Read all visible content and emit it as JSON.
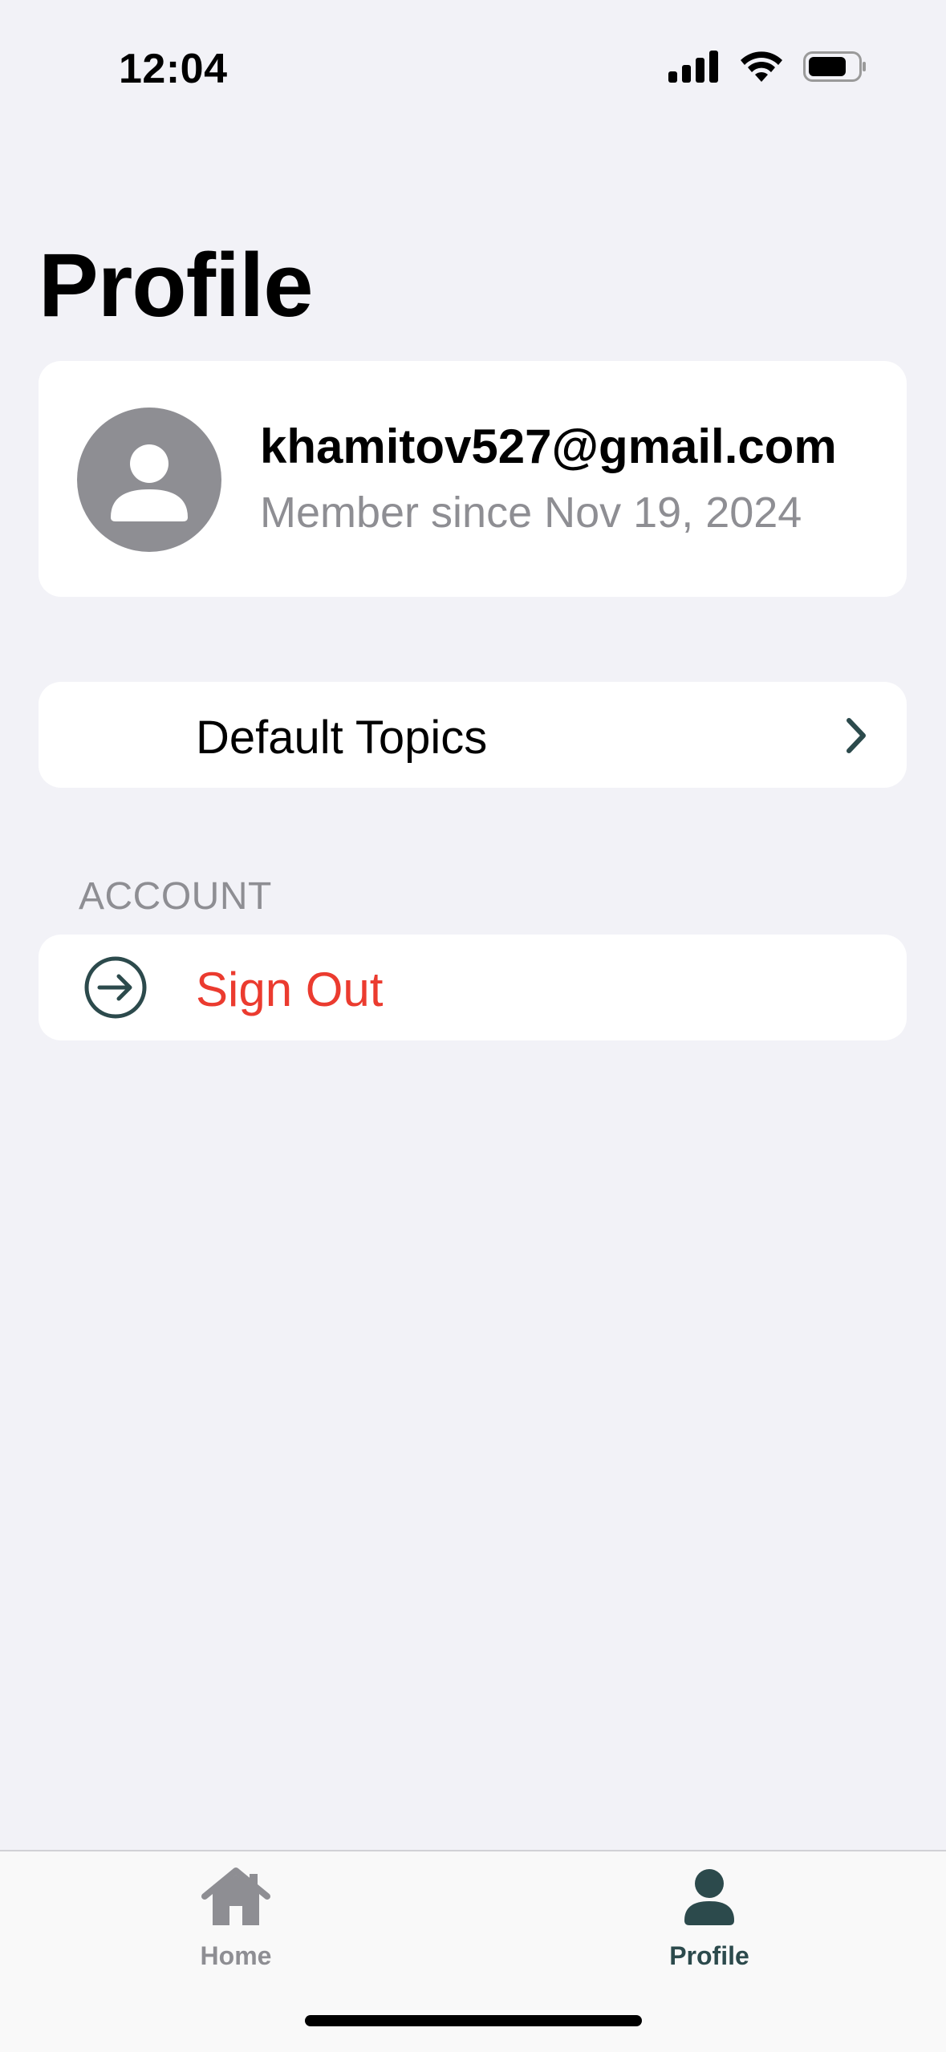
{
  "status_bar": {
    "time": "12:04",
    "icons": [
      "cellular-signal-icon",
      "wifi-icon",
      "battery-icon"
    ]
  },
  "page": {
    "title": "Profile"
  },
  "profile": {
    "email": "khamitov527@gmail.com",
    "member_since": "Member since Nov 19, 2024",
    "avatar_icon": "person-placeholder-icon"
  },
  "settings": {
    "default_topics_label": "Default Topics",
    "chevron_icon": "chevron-right-icon"
  },
  "account_section": {
    "header": "ACCOUNT",
    "sign_out_label": "Sign Out",
    "sign_out_icon": "arrow-right-circle-icon"
  },
  "tab_bar": {
    "tabs": [
      {
        "label": "Home",
        "icon": "house-icon",
        "selected": false
      },
      {
        "label": "Profile",
        "icon": "person-icon",
        "selected": true
      }
    ]
  },
  "colors": {
    "background": "#f2f2f7",
    "card": "#ffffff",
    "secondary_text": "#8e8e93",
    "destructive": "#eb3b2f",
    "accent": "#2c4a4c"
  }
}
